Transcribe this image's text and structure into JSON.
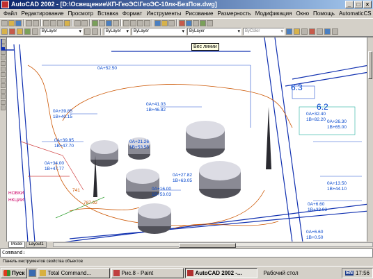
{
  "window": {
    "title": "AutoCAD 2002 - [D:\\Освещение\\КП-ГеоЭС\\ГеоЭС-10лк-БезПов.dwg]"
  },
  "window_buttons": {
    "minimize": "_",
    "maximize": "□",
    "close": "×"
  },
  "menu": [
    "Файл",
    "Редактирование",
    "Просмотр",
    "Вставка",
    "Формат",
    "Инструменты",
    "Рисование",
    "Размерность",
    "Модификация",
    "Окно",
    "Помощь",
    "AutomaticCS"
  ],
  "mdi_buttons": {
    "minimize": "_",
    "restore": "▫",
    "close": "×"
  },
  "properties_toolbar": {
    "layer_combo": "ByLayer",
    "linetype_combo": "ByLayer",
    "lineweight_combo": "ByLayer",
    "plotstyle_combo": "ByColor",
    "tooltip": "Вес линии"
  },
  "drawing_labels": [
    {
      "text": "0A+52.50",
      "color": "#0044cc"
    },
    {
      "text": "0A+39.85",
      "color": "#0044cc"
    },
    {
      "text": "1B+40.15",
      "color": "#0044cc"
    },
    {
      "text": "0A+41.03",
      "color": "#0044cc"
    },
    {
      "text": "1B+46.82",
      "color": "#0044cc"
    },
    {
      "text": "0A+39.95",
      "color": "#0044cc"
    },
    {
      "text": "1B+47.70",
      "color": "#0044cc"
    },
    {
      "text": "0A+21.26",
      "color": "#0044cc"
    },
    {
      "text": "1B+53.55",
      "color": "#0044cc"
    },
    {
      "text": "0A+34.00",
      "color": "#0044cc"
    },
    {
      "text": "1B+47.77",
      "color": "#0044cc"
    },
    {
      "text": "0A+27.82",
      "color": "#0044cc"
    },
    {
      "text": "1B+63.05",
      "color": "#0044cc"
    },
    {
      "text": "0A+16.00",
      "color": "#0044cc"
    },
    {
      "text": "1B+53.03",
      "color": "#0044cc"
    },
    {
      "text": "0A+32.40",
      "color": "#0044cc"
    },
    {
      "text": "1B+82.20",
      "color": "#0044cc"
    },
    {
      "text": "0A+26.30",
      "color": "#0044cc"
    },
    {
      "text": "1B+65.00",
      "color": "#0044cc"
    },
    {
      "text": "0A+13.50",
      "color": "#0044cc"
    },
    {
      "text": "1B+44.10",
      "color": "#0044cc"
    },
    {
      "text": "0A+6.60",
      "color": "#0044cc"
    },
    {
      "text": "1B+32.93",
      "color": "#0044cc"
    },
    {
      "text": "0A+6.60",
      "color": "#0044cc"
    },
    {
      "text": "1B+0.50",
      "color": "#0044cc"
    },
    {
      "text": "6.3",
      "color": "#0044cc"
    },
    {
      "text": "6.2",
      "color": "#0044cc"
    },
    {
      "text": "787.92",
      "color": "#cc5500"
    },
    {
      "text": "741",
      "color": "#cc5500"
    },
    {
      "text": "НОВКИ",
      "color": "#cc0066"
    },
    {
      "text": "НКЦИИ",
      "color": "#cc0066"
    }
  ],
  "tabs": [
    "Model",
    "Layout1"
  ],
  "command_line": {
    "prompt": "Command:"
  },
  "status_bar": {
    "text": "Панель инструментов свойства объектов"
  },
  "taskbar": {
    "start": "Пуск",
    "tasks": [
      {
        "label": "Total Command...",
        "active": false
      },
      {
        "label": "Рис.8 - Paint",
        "active": false
      },
      {
        "label": "AutoCAD 2002 -...",
        "active": true
      }
    ],
    "desktop_label": "Рабочий стол",
    "language": "EN",
    "clock": "17:56"
  },
  "colors": {
    "title_start": "#0a246a",
    "title_end": "#a6caf0",
    "dimension_blue": "#0044cc",
    "contour_orange": "#cc5500",
    "canvas": "#ffffff"
  }
}
